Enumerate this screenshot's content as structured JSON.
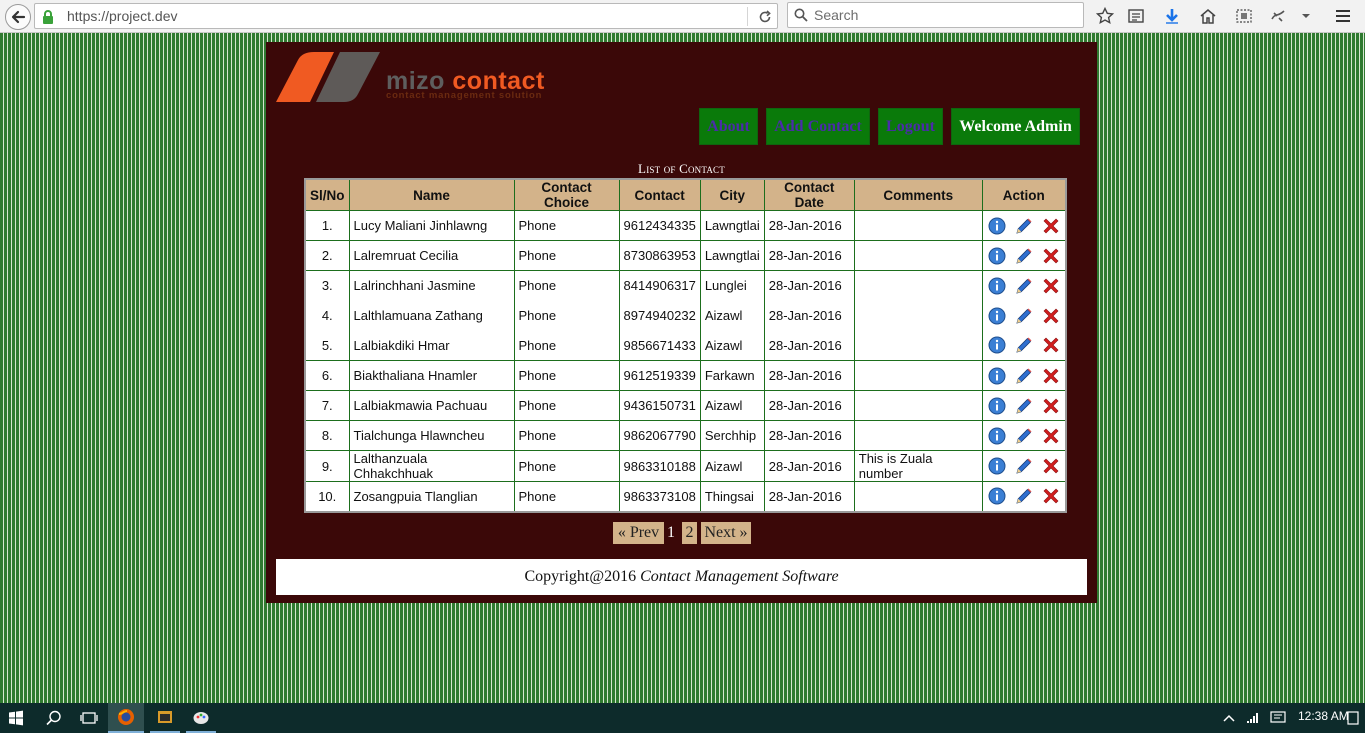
{
  "browser": {
    "url": "https://project.dev",
    "search_placeholder": "Search"
  },
  "logo": {
    "word1": "mizo",
    "word2": "contact",
    "tagline": "contact management solution"
  },
  "menu": {
    "about": "About",
    "add_contact": "Add Contact",
    "logout": "Logout",
    "welcome": "Welcome Admin"
  },
  "list_title": "List of Contact",
  "table": {
    "headers": [
      "Sl/No",
      "Name",
      "Contact Choice",
      "Contact",
      "City",
      "Contact Date",
      "Comments",
      "Action"
    ],
    "rows": [
      {
        "sl": "1.",
        "name": "Lucy Maliani Jinhlawng",
        "choice": "Phone",
        "contact": "9612434335",
        "city": "Lawngtlai",
        "date": "28-Jan-2016",
        "comments": ""
      },
      {
        "sl": "2.",
        "name": "Lalremruat Cecilia",
        "choice": "Phone",
        "contact": "8730863953",
        "city": "Lawngtlai",
        "date": "28-Jan-2016",
        "comments": ""
      },
      {
        "sl": "3.",
        "name": "Lalrinchhani Jasmine",
        "choice": "Phone",
        "contact": "8414906317",
        "city": "Lunglei",
        "date": "28-Jan-2016",
        "comments": ""
      },
      {
        "sl": "4.",
        "name": "Lalthlamuana Zathang",
        "choice": "Phone",
        "contact": "8974940232",
        "city": "Aizawl",
        "date": "28-Jan-2016",
        "comments": ""
      },
      {
        "sl": "5.",
        "name": "Lalbiakdiki Hmar",
        "choice": "Phone",
        "contact": "9856671433",
        "city": "Aizawl",
        "date": "28-Jan-2016",
        "comments": ""
      },
      {
        "sl": "6.",
        "name": "Biakthaliana Hnamler",
        "choice": "Phone",
        "contact": "9612519339",
        "city": "Farkawn",
        "date": "28-Jan-2016",
        "comments": ""
      },
      {
        "sl": "7.",
        "name": "Lalbiakmawia Pachuau",
        "choice": "Phone",
        "contact": "9436150731",
        "city": "Aizawl",
        "date": "28-Jan-2016",
        "comments": ""
      },
      {
        "sl": "8.",
        "name": "Tialchunga Hlawncheu",
        "choice": "Phone",
        "contact": "9862067790",
        "city": "Serchhip",
        "date": "28-Jan-2016",
        "comments": ""
      },
      {
        "sl": "9.",
        "name": "Lalthanzuala Chhakchhuak",
        "choice": "Phone",
        "contact": "9863310188",
        "city": "Aizawl",
        "date": "28-Jan-2016",
        "comments": "This is Zuala number"
      },
      {
        "sl": "10.",
        "name": "Zosangpuia Tlanglian",
        "choice": "Phone",
        "contact": "9863373108",
        "city": "Thingsai",
        "date": "28-Jan-2016",
        "comments": ""
      }
    ]
  },
  "pagination": {
    "prev": "« Prev",
    "pages": [
      "1",
      "2"
    ],
    "current": "1",
    "next": "Next »"
  },
  "footer": {
    "copyright": "Copyright@2016",
    "product": "Contact Management Software"
  },
  "taskbar": {
    "time": "12:38 AM"
  },
  "colors": {
    "panel_bg": "#3b0808",
    "menu_bg": "#0a7a0a",
    "header_bg": "#d3b38a",
    "accent_orange": "#f05a22",
    "page_stripes": "#2f7a30"
  }
}
